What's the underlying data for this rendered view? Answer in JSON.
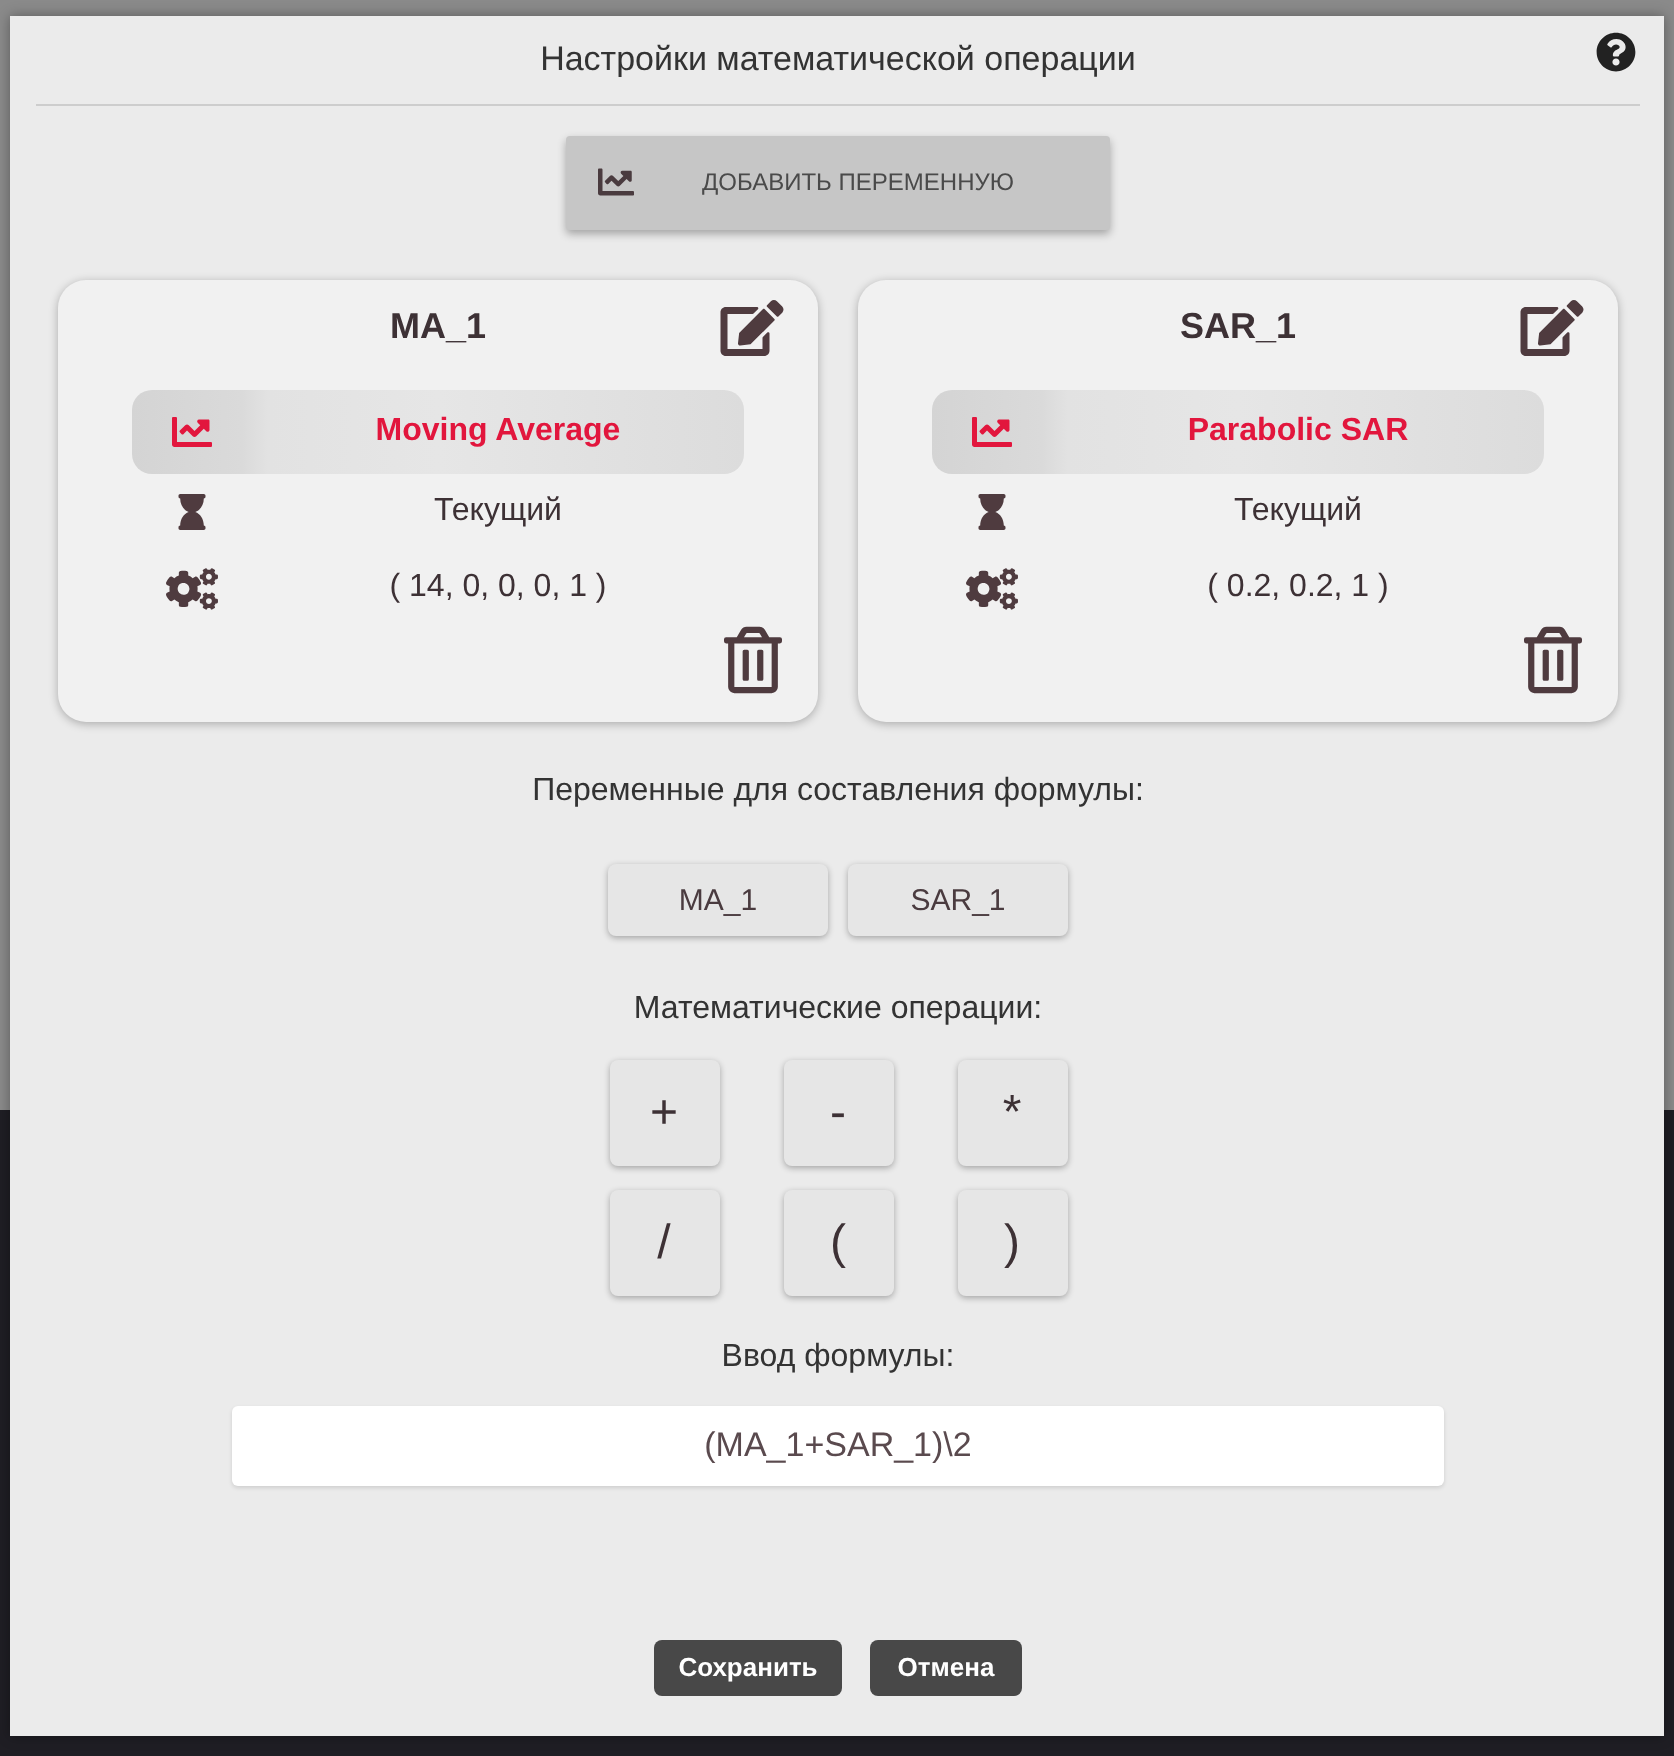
{
  "dialog": {
    "title": "Настройки математической операции"
  },
  "add_variable_button": {
    "label": "ДОБАВИТЬ ПЕРЕМЕННУЮ"
  },
  "variables": [
    {
      "name": "MA_1",
      "indicator": "Moving Average",
      "timeframe": "Текущий",
      "parameters": "( 14, 0, 0, 0, 1 )"
    },
    {
      "name": "SAR_1",
      "indicator": "Parabolic SAR",
      "timeframe": "Текущий",
      "parameters": "( 0.2, 0.2, 1 )"
    }
  ],
  "formula_variables": {
    "heading": "Переменные для составления формулы:",
    "items": [
      "MA_1",
      "SAR_1"
    ]
  },
  "operations": {
    "heading": "Математические операции:",
    "items": [
      "+",
      "-",
      "*",
      "/",
      "(",
      ")"
    ]
  },
  "formula": {
    "label": "Ввод формулы:",
    "value": "(MA_1+SAR_1)\\2"
  },
  "footer_buttons": [
    {
      "label": "Сохранить"
    },
    {
      "label": "Отмена"
    }
  ]
}
